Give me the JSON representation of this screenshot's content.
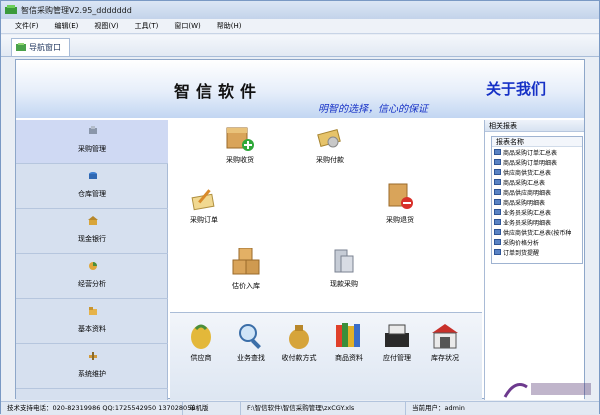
{
  "window": {
    "title": "智信采购管理V2.95_ddddddd"
  },
  "menu": [
    "文件(F)",
    "编辑(E)",
    "视图(V)",
    "工具(T)",
    "窗口(W)",
    "帮助(H)"
  ],
  "tab": {
    "label": "导航窗口"
  },
  "banner": {
    "title": "智信软件",
    "about": "关于我们",
    "slogan": "明智的选择，信心的保证"
  },
  "sidebar": {
    "items": [
      {
        "label": "采购管理",
        "icon": "cart-icon",
        "active": true
      },
      {
        "label": "仓库管理",
        "icon": "warehouse-icon"
      },
      {
        "label": "现金银行",
        "icon": "bank-icon"
      },
      {
        "label": "经营分析",
        "icon": "analysis-icon"
      },
      {
        "label": "基本资料",
        "icon": "folder-icon"
      },
      {
        "label": "系统维护",
        "icon": "tools-icon"
      }
    ]
  },
  "actions": {
    "receive": "采购收货",
    "payment": "采购付款",
    "order": "采购订单",
    "returns": "采购退货",
    "price_inbound": "估价入库",
    "cash_purchase": "现款采购"
  },
  "bottom": {
    "items": [
      "供应商",
      "业务查找",
      "收付款方式",
      "商品资料",
      "应付管理",
      "库存状况"
    ]
  },
  "reports": {
    "header": "相关报表",
    "column": "报表名称",
    "items": [
      "商品采购订单汇总表",
      "商品采购订单明细表",
      "供应商供货汇总表",
      "商品采购汇总表",
      "商品供应商明细表",
      "商品采购明细表",
      "业务员采购汇总表",
      "业务员采购明细表",
      "供应商供货汇总表(按币种",
      "采购价格分析",
      "订单到货提醒"
    ]
  },
  "status": {
    "support": "技术支持电话：020-82319986 QQ:1725542950 137028056",
    "mode": "单机版",
    "path": "F:\\智信软件\\智信采购管理\\zxCGY.xls",
    "user": "当前用户：admin"
  },
  "colors": {
    "accent": "#1631c6",
    "sidebar": "#d6e0ef",
    "active": "#cfd9f3"
  }
}
